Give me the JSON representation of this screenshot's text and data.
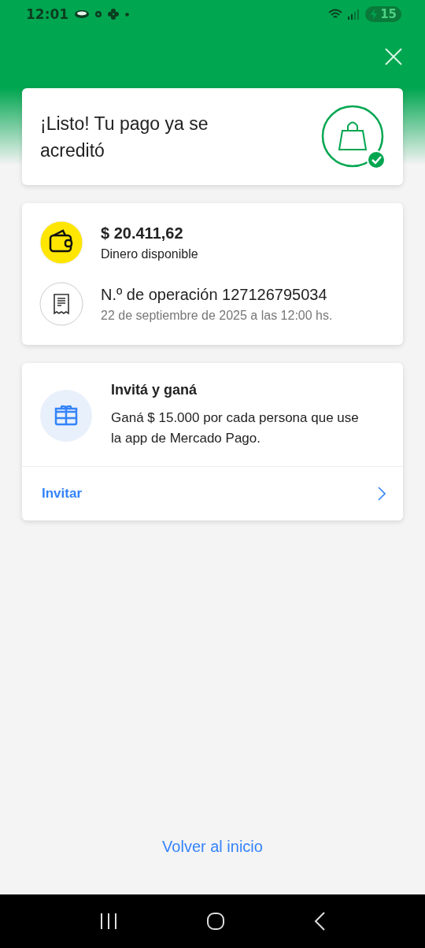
{
  "status_bar": {
    "time": "12:01",
    "battery": "15"
  },
  "success_card": {
    "title": "¡Listo! Tu pago ya se acreditó"
  },
  "details": [
    {
      "kind": "wallet",
      "primary": "$ 20.411,62",
      "secondary": "Dinero disponible"
    },
    {
      "kind": "receipt",
      "primary": "N.º de operación 127126795034",
      "secondary": "22 de septiembre de 2025 a las 12:00 hs."
    }
  ],
  "invite_card": {
    "title": "Invitá y ganá",
    "text": "Ganá $ 15.000 por cada persona que use la app de Mercado Pago.",
    "action": "Invitar"
  },
  "footer_link": "Volver al inicio"
}
